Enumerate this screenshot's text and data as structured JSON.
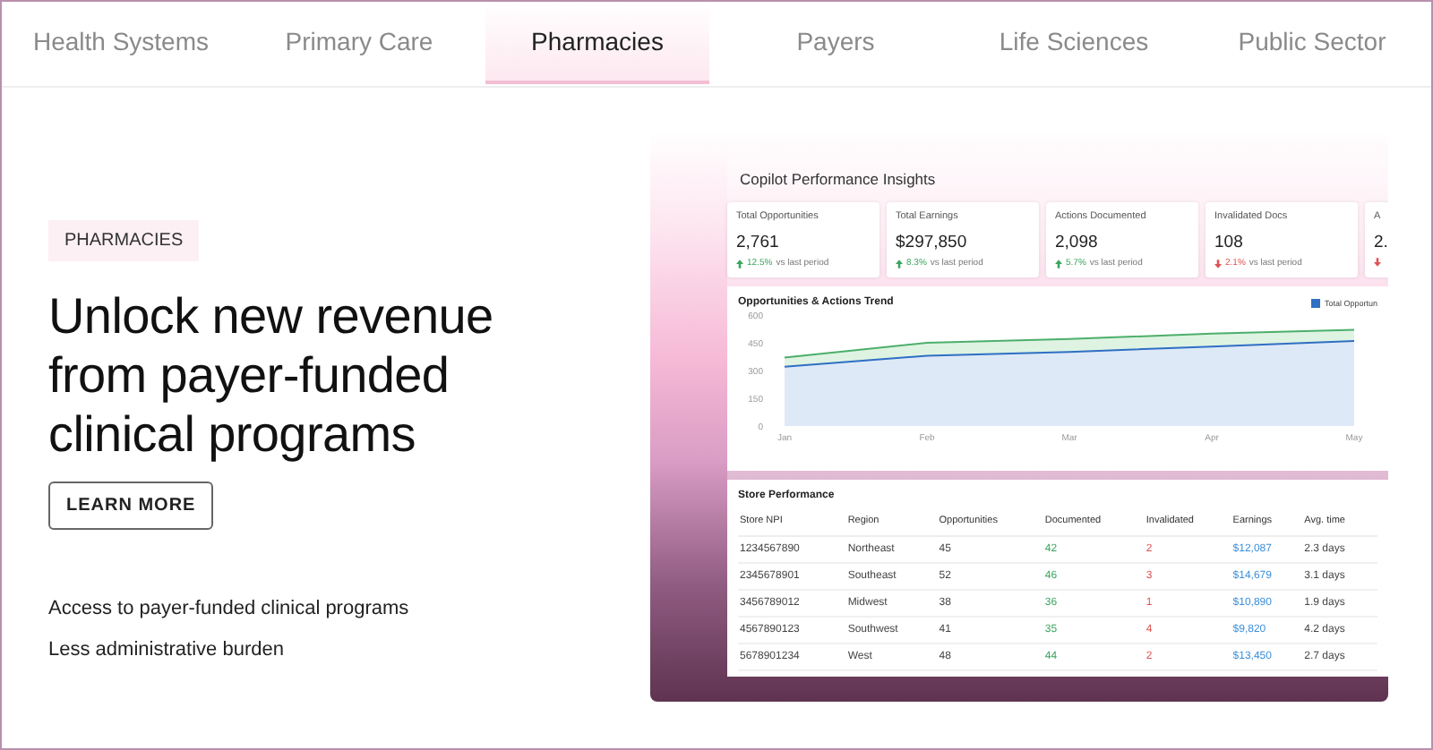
{
  "tabs": [
    {
      "label": "Health Systems",
      "selected": false
    },
    {
      "label": "Primary Care",
      "selected": false
    },
    {
      "label": "Pharmacies",
      "selected": true
    },
    {
      "label": "Payers",
      "selected": false
    },
    {
      "label": "Life Sciences",
      "selected": false
    },
    {
      "label": "Public Sector",
      "selected": false
    }
  ],
  "hero": {
    "badge": "PHARMACIES",
    "heading": "Unlock new revenue from payer-funded clinical programs",
    "button": "LEARN MORE",
    "benefits": [
      "Access to payer-funded clinical programs",
      "Less administrative burden"
    ]
  },
  "dashboard": {
    "title": "Copilot Performance Insights",
    "metrics": [
      {
        "label": "Total Opportunities",
        "value": "2,761",
        "increase": true,
        "delta": "12.5%",
        "note": "vs last period"
      },
      {
        "label": "Total Earnings",
        "value": "$297,850",
        "increase": true,
        "delta": "8.3%",
        "note": "vs last period"
      },
      {
        "label": "Actions Documented",
        "value": "2,098",
        "increase": true,
        "delta": "5.7%",
        "note": "vs last period"
      },
      {
        "label": "Invalidated Docs",
        "value": "108",
        "increase": false,
        "delta": "2.1%",
        "note": "vs last period"
      },
      {
        "label": "A",
        "value": "2.",
        "increase": false
      }
    ],
    "trend_chart": {
      "title": "Opportunities & Actions Trend",
      "chart_data": {
        "type": "area",
        "categories": [
          "Jan",
          "Feb",
          "Mar",
          "Apr",
          "May"
        ],
        "ylim": [
          0,
          600
        ],
        "yticks": [
          0,
          150,
          300,
          450,
          600
        ],
        "series": [
          {
            "name": "Total Opportun",
            "color": "#2f6fc4",
            "values": [
              320,
              380,
              400,
              430,
              460
            ]
          },
          {
            "color": "#4caf6a",
            "values": [
              370,
              450,
              470,
              500,
              520
            ]
          }
        ]
      }
    },
    "store_table": {
      "title": "Store Performance",
      "columns": [
        {
          "label": "Store NPI"
        },
        {
          "label": "Region"
        },
        {
          "label": "Opportunities"
        },
        {
          "label": "Documented",
          "color": "#3aa55d"
        },
        {
          "label": "Invalidated",
          "color": "#e05252"
        },
        {
          "label": "Earnings",
          "color": "#3b8fd9"
        },
        {
          "label": "Avg. time"
        }
      ],
      "rows": [
        [
          "1234567890",
          "Northeast",
          "45",
          "42",
          "2",
          "$12,087",
          "2.3 days"
        ],
        [
          "2345678901",
          "Southeast",
          "52",
          "46",
          "3",
          "$14,679",
          "3.1 days"
        ],
        [
          "3456789012",
          "Midwest",
          "38",
          "36",
          "1",
          "$10,890",
          "1.9 days"
        ],
        [
          "4567890123",
          "Southwest",
          "41",
          "35",
          "4",
          "$9,820",
          "4.2 days"
        ],
        [
          "5678901234",
          "West",
          "48",
          "44",
          "2",
          "$13,450",
          "2.7 days"
        ]
      ]
    }
  }
}
